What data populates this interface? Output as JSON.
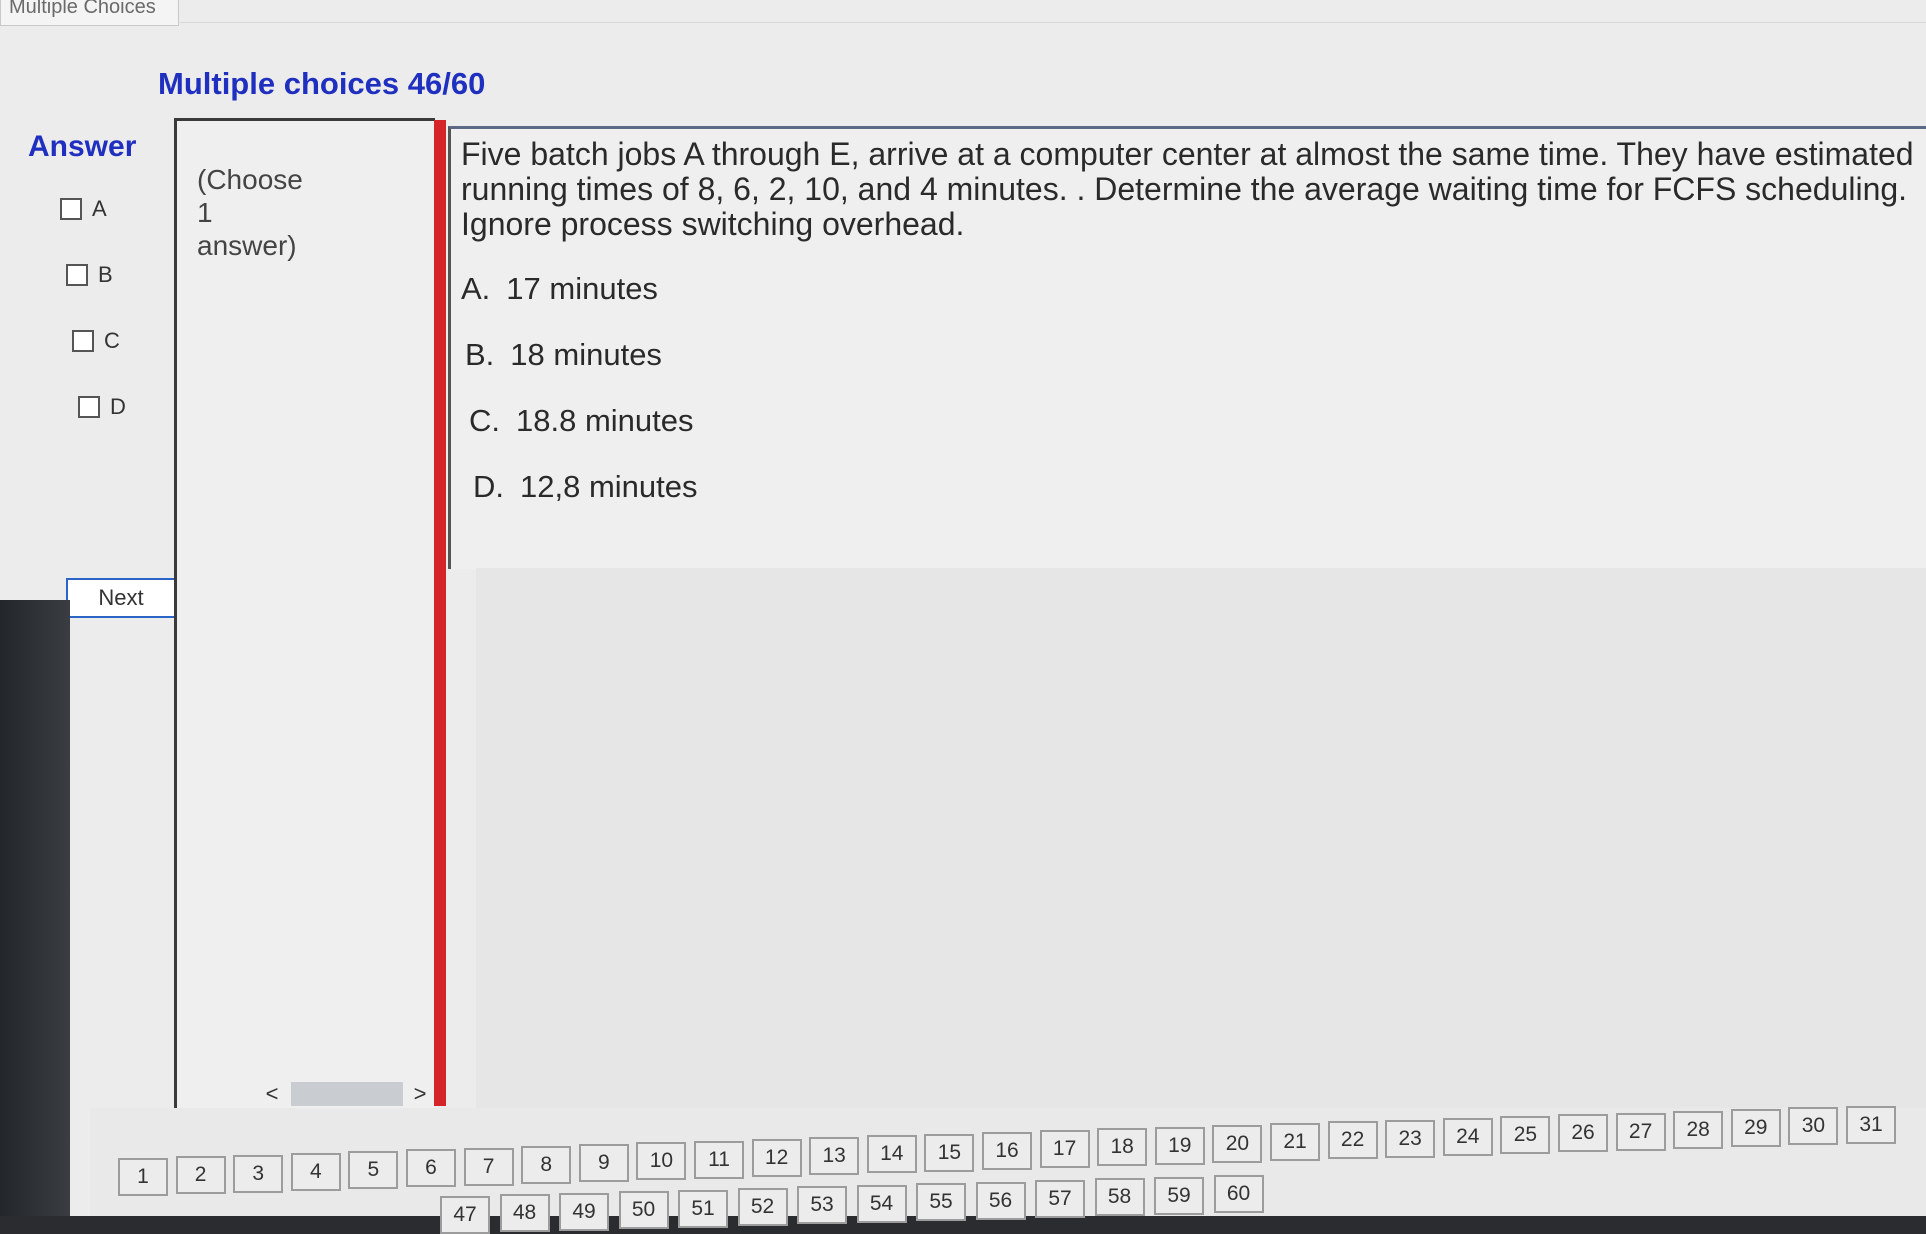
{
  "window": {
    "tab_title": "Multiple Choices"
  },
  "header": {
    "title": "Multiple choices 46/60"
  },
  "answer": {
    "label": "Answer",
    "options": [
      "A",
      "B",
      "C",
      "D"
    ],
    "next_label": "Next"
  },
  "choose_panel": {
    "text": "(Choose 1 answer)"
  },
  "scrollbar": {
    "left_arrow": "<",
    "right_arrow": ">"
  },
  "question": {
    "text": "Five batch jobs A through E, arrive at a computer center at almost the same time. They have estimated running times of 8, 6, 2, 10, and 4 minutes. . Determine the average waiting  time for FCFS scheduling. Ignore process switching overhead.",
    "choices": [
      {
        "letter": "A.",
        "text": "17 minutes"
      },
      {
        "letter": "B.",
        "text": "18 minutes"
      },
      {
        "letter": "C.",
        "text": "18.8 minutes"
      },
      {
        "letter": "D.",
        "text": "12,8 minutes"
      }
    ]
  },
  "pager": {
    "row1": [
      "1",
      "2",
      "3",
      "4",
      "5",
      "6",
      "7",
      "8",
      "9",
      "10",
      "11",
      "12",
      "13",
      "14",
      "15",
      "16",
      "17",
      "18",
      "19",
      "20",
      "21",
      "22",
      "23",
      "24",
      "25",
      "26",
      "27",
      "28",
      "29",
      "30",
      "31"
    ],
    "row2": [
      "47",
      "48",
      "49",
      "50",
      "51",
      "52",
      "53",
      "54",
      "55",
      "56",
      "57",
      "58",
      "59",
      "60"
    ]
  }
}
